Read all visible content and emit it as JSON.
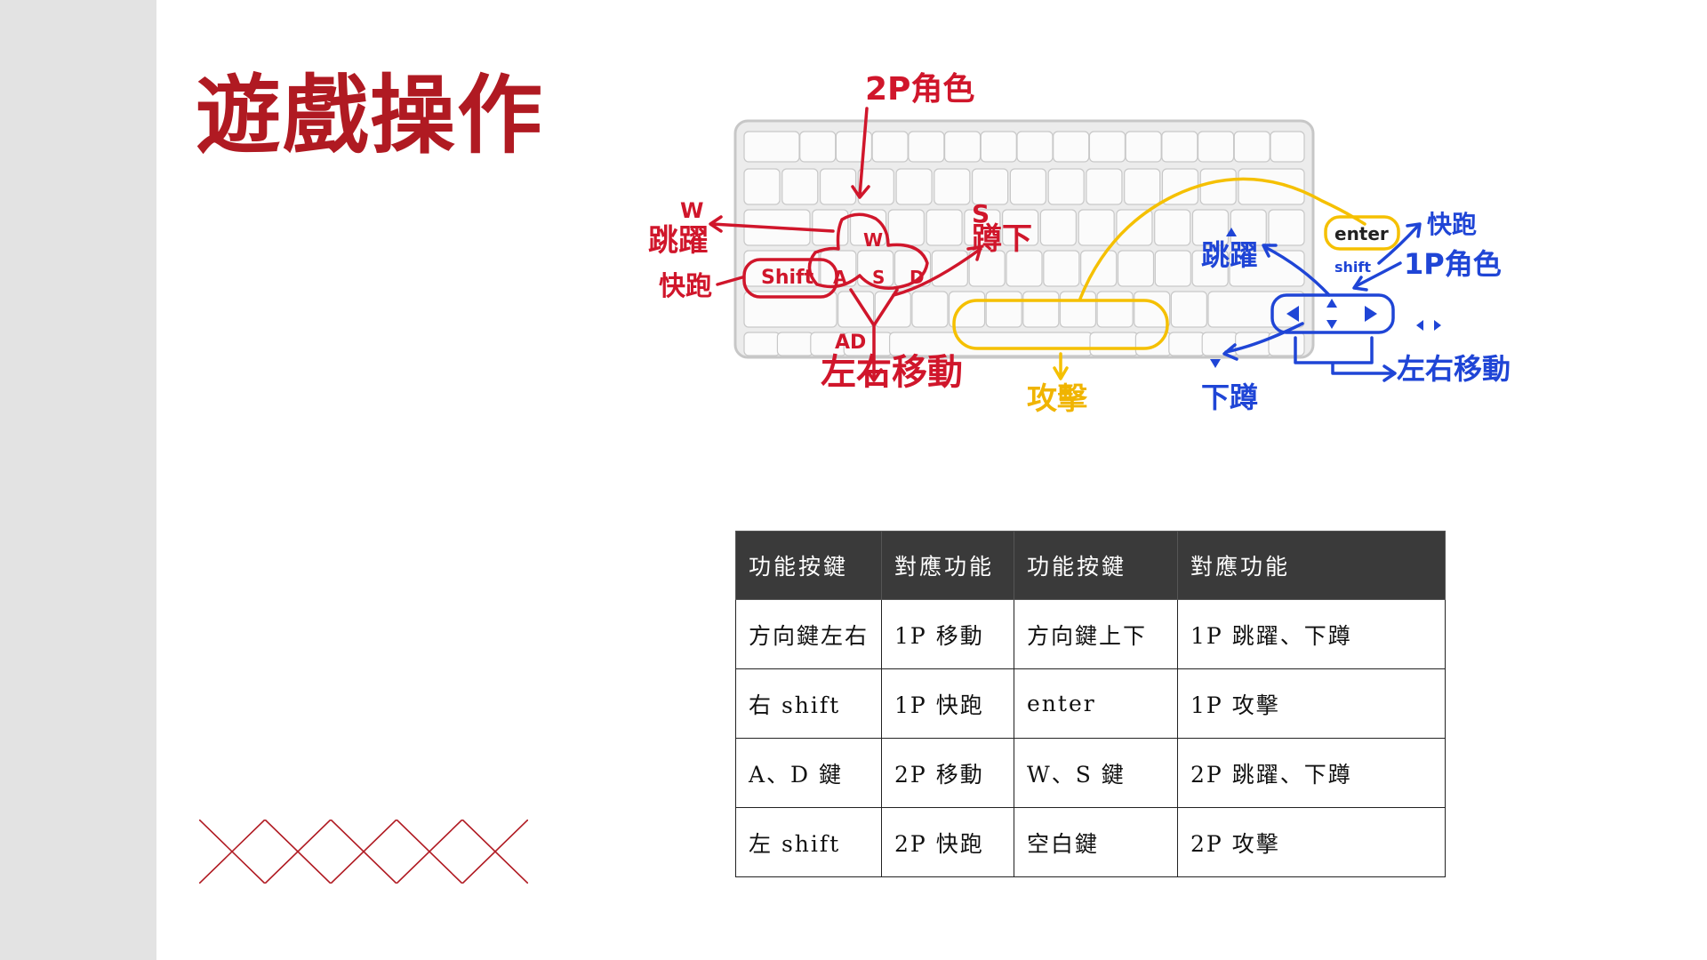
{
  "slide": {
    "title": "遊戲操作",
    "title_color": "#b01a22",
    "accent_color": "#b01a22",
    "sidebar_color": "#e3e3e3"
  },
  "keyboard_figure": {
    "annotations": {
      "p2_character": "2P角色",
      "w_key": "W",
      "jump_2p": "跳躍",
      "shift_key": "Shift",
      "dash_2p": "快跑",
      "ad_keys": "AD",
      "move_2p": "左右移動",
      "s_key": "S",
      "crouch_2p": "蹲下",
      "attack": "攻擊",
      "enter_key": "enter",
      "shift_right_key": "shift",
      "dash_1p": "快跑",
      "p1_character": "1P角色",
      "jump_1p": "跳躍",
      "crouch_1p": "下蹲",
      "move_1p": "左右移動"
    },
    "key_letters": {
      "w": "W",
      "a": "A",
      "s": "S",
      "d": "D"
    },
    "annotation_colors": {
      "player2": "#d0162b",
      "player1": "#1f45d6",
      "attack": "#f5c000"
    }
  },
  "controls_table": {
    "headers": [
      "功能按鍵",
      "對應功能",
      "功能按鍵",
      "對應功能"
    ],
    "rows": [
      [
        "方向鍵左右",
        "1P 移動",
        "方向鍵上下",
        "1P 跳躍、下蹲"
      ],
      [
        "右 shift",
        "1P 快跑",
        "enter",
        "1P 攻擊"
      ],
      [
        "A、D 鍵",
        "2P 移動",
        "W、S 鍵",
        "2P 跳躍、下蹲"
      ],
      [
        "左 shift",
        "2P 快跑",
        "空白鍵",
        "2P 攻擊"
      ]
    ]
  }
}
